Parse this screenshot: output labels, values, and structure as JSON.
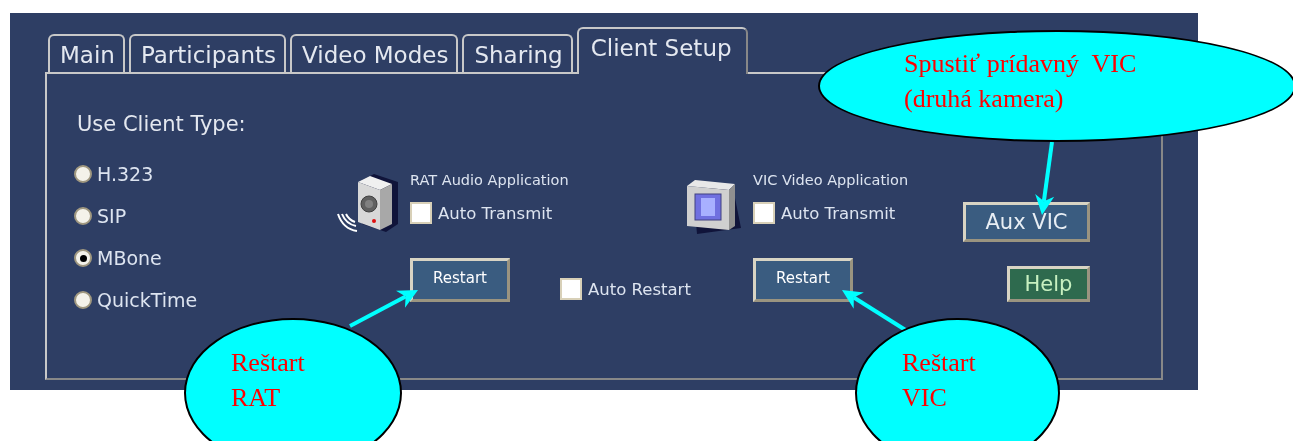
{
  "tabs": [
    {
      "label": "Main",
      "selected": false
    },
    {
      "label": "Participants",
      "selected": false
    },
    {
      "label": "Video Modes",
      "selected": false
    },
    {
      "label": "Sharing",
      "selected": false
    },
    {
      "label": "Client Setup",
      "selected": true
    }
  ],
  "client_type": {
    "label": "Use Client Type:",
    "options": [
      {
        "label": "H.323",
        "selected": false
      },
      {
        "label": "SIP",
        "selected": false
      },
      {
        "label": "MBone",
        "selected": true
      },
      {
        "label": "QuickTime",
        "selected": false
      }
    ]
  },
  "apps": [
    {
      "kind": "audio",
      "title": "RAT Audio Application",
      "auto_transmit": {
        "label": "Auto Transmit",
        "checked": false
      },
      "restart": "Restart"
    },
    {
      "kind": "video",
      "title": "VIC Video Application",
      "auto_transmit": {
        "label": "Auto Transmit",
        "checked": false
      },
      "restart": "Restart"
    }
  ],
  "auto_restart": {
    "label": "Auto Restart",
    "checked": false
  },
  "buttons": [
    {
      "kind": "primary",
      "label": "Aux VIC"
    },
    {
      "kind": "help",
      "label": "Help"
    }
  ],
  "callouts": [
    {
      "text": "Spustiť prídavný  VIC\n(druhá kamera)"
    },
    {
      "text": "Reštart\nRAT"
    },
    {
      "text": "Reštart\nVIC"
    }
  ]
}
